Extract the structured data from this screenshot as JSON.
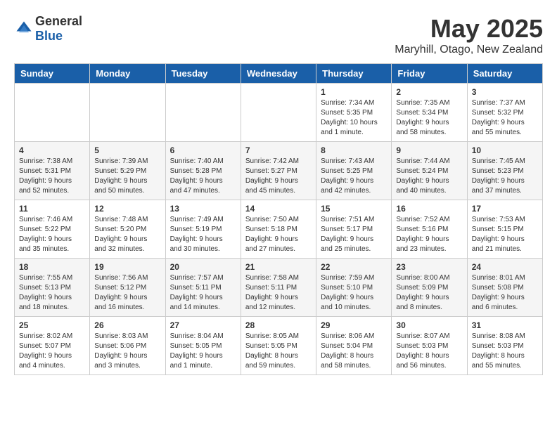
{
  "header": {
    "logo": {
      "general": "General",
      "blue": "Blue"
    },
    "title": "May 2025",
    "location": "Maryhill, Otago, New Zealand"
  },
  "calendar": {
    "days_of_week": [
      "Sunday",
      "Monday",
      "Tuesday",
      "Wednesday",
      "Thursday",
      "Friday",
      "Saturday"
    ],
    "weeks": [
      [
        {
          "day": "",
          "info": ""
        },
        {
          "day": "",
          "info": ""
        },
        {
          "day": "",
          "info": ""
        },
        {
          "day": "",
          "info": ""
        },
        {
          "day": "1",
          "info": "Sunrise: 7:34 AM\nSunset: 5:35 PM\nDaylight: 10 hours\nand 1 minute."
        },
        {
          "day": "2",
          "info": "Sunrise: 7:35 AM\nSunset: 5:34 PM\nDaylight: 9 hours\nand 58 minutes."
        },
        {
          "day": "3",
          "info": "Sunrise: 7:37 AM\nSunset: 5:32 PM\nDaylight: 9 hours\nand 55 minutes."
        }
      ],
      [
        {
          "day": "4",
          "info": "Sunrise: 7:38 AM\nSunset: 5:31 PM\nDaylight: 9 hours\nand 52 minutes."
        },
        {
          "day": "5",
          "info": "Sunrise: 7:39 AM\nSunset: 5:29 PM\nDaylight: 9 hours\nand 50 minutes."
        },
        {
          "day": "6",
          "info": "Sunrise: 7:40 AM\nSunset: 5:28 PM\nDaylight: 9 hours\nand 47 minutes."
        },
        {
          "day": "7",
          "info": "Sunrise: 7:42 AM\nSunset: 5:27 PM\nDaylight: 9 hours\nand 45 minutes."
        },
        {
          "day": "8",
          "info": "Sunrise: 7:43 AM\nSunset: 5:25 PM\nDaylight: 9 hours\nand 42 minutes."
        },
        {
          "day": "9",
          "info": "Sunrise: 7:44 AM\nSunset: 5:24 PM\nDaylight: 9 hours\nand 40 minutes."
        },
        {
          "day": "10",
          "info": "Sunrise: 7:45 AM\nSunset: 5:23 PM\nDaylight: 9 hours\nand 37 minutes."
        }
      ],
      [
        {
          "day": "11",
          "info": "Sunrise: 7:46 AM\nSunset: 5:22 PM\nDaylight: 9 hours\nand 35 minutes."
        },
        {
          "day": "12",
          "info": "Sunrise: 7:48 AM\nSunset: 5:20 PM\nDaylight: 9 hours\nand 32 minutes."
        },
        {
          "day": "13",
          "info": "Sunrise: 7:49 AM\nSunset: 5:19 PM\nDaylight: 9 hours\nand 30 minutes."
        },
        {
          "day": "14",
          "info": "Sunrise: 7:50 AM\nSunset: 5:18 PM\nDaylight: 9 hours\nand 27 minutes."
        },
        {
          "day": "15",
          "info": "Sunrise: 7:51 AM\nSunset: 5:17 PM\nDaylight: 9 hours\nand 25 minutes."
        },
        {
          "day": "16",
          "info": "Sunrise: 7:52 AM\nSunset: 5:16 PM\nDaylight: 9 hours\nand 23 minutes."
        },
        {
          "day": "17",
          "info": "Sunrise: 7:53 AM\nSunset: 5:15 PM\nDaylight: 9 hours\nand 21 minutes."
        }
      ],
      [
        {
          "day": "18",
          "info": "Sunrise: 7:55 AM\nSunset: 5:13 PM\nDaylight: 9 hours\nand 18 minutes."
        },
        {
          "day": "19",
          "info": "Sunrise: 7:56 AM\nSunset: 5:12 PM\nDaylight: 9 hours\nand 16 minutes."
        },
        {
          "day": "20",
          "info": "Sunrise: 7:57 AM\nSunset: 5:11 PM\nDaylight: 9 hours\nand 14 minutes."
        },
        {
          "day": "21",
          "info": "Sunrise: 7:58 AM\nSunset: 5:11 PM\nDaylight: 9 hours\nand 12 minutes."
        },
        {
          "day": "22",
          "info": "Sunrise: 7:59 AM\nSunset: 5:10 PM\nDaylight: 9 hours\nand 10 minutes."
        },
        {
          "day": "23",
          "info": "Sunrise: 8:00 AM\nSunset: 5:09 PM\nDaylight: 9 hours\nand 8 minutes."
        },
        {
          "day": "24",
          "info": "Sunrise: 8:01 AM\nSunset: 5:08 PM\nDaylight: 9 hours\nand 6 minutes."
        }
      ],
      [
        {
          "day": "25",
          "info": "Sunrise: 8:02 AM\nSunset: 5:07 PM\nDaylight: 9 hours\nand 4 minutes."
        },
        {
          "day": "26",
          "info": "Sunrise: 8:03 AM\nSunset: 5:06 PM\nDaylight: 9 hours\nand 3 minutes."
        },
        {
          "day": "27",
          "info": "Sunrise: 8:04 AM\nSunset: 5:05 PM\nDaylight: 9 hours\nand 1 minute."
        },
        {
          "day": "28",
          "info": "Sunrise: 8:05 AM\nSunset: 5:05 PM\nDaylight: 8 hours\nand 59 minutes."
        },
        {
          "day": "29",
          "info": "Sunrise: 8:06 AM\nSunset: 5:04 PM\nDaylight: 8 hours\nand 58 minutes."
        },
        {
          "day": "30",
          "info": "Sunrise: 8:07 AM\nSunset: 5:03 PM\nDaylight: 8 hours\nand 56 minutes."
        },
        {
          "day": "31",
          "info": "Sunrise: 8:08 AM\nSunset: 5:03 PM\nDaylight: 8 hours\nand 55 minutes."
        }
      ]
    ]
  }
}
